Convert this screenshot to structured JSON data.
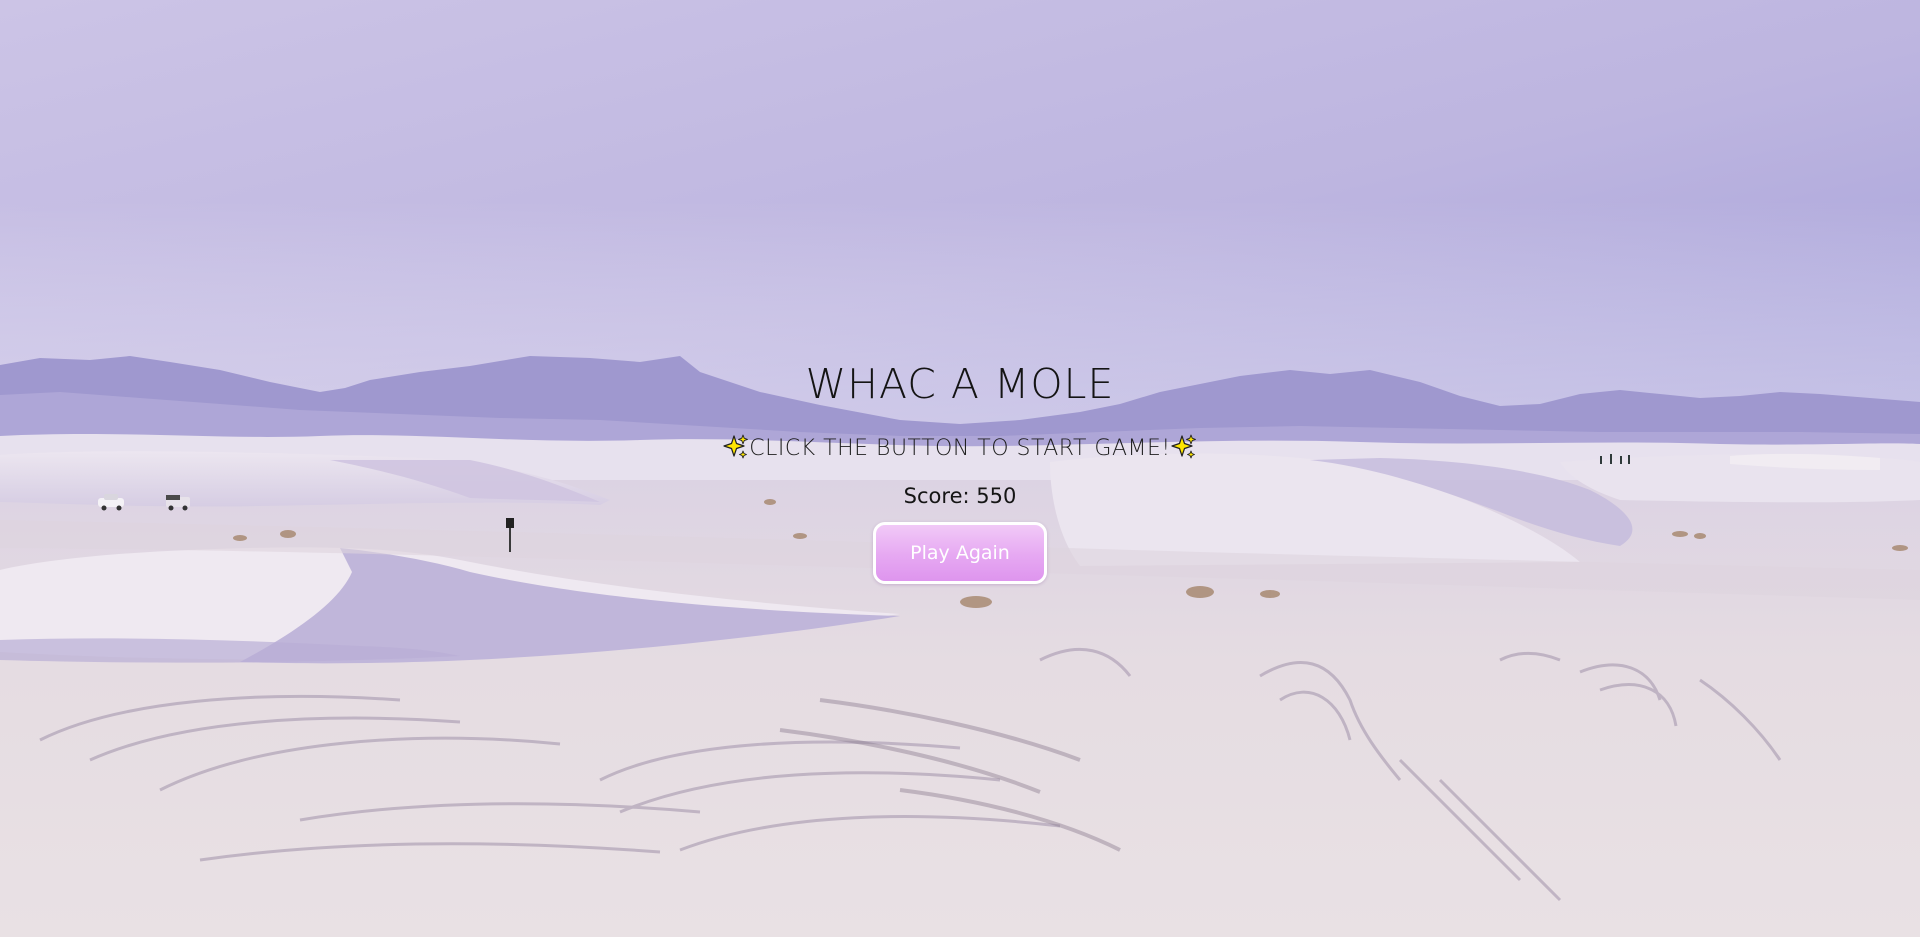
{
  "game": {
    "title": "WHAC A MOLE",
    "instruction": "CLICK THE BUTTON TO START GAME!",
    "score_label": "Score: 550",
    "play_button_label": "Play Again"
  },
  "icons": {
    "sparkle_left": "sparkles-icon",
    "sparkle_right": "sparkles-icon"
  },
  "colors": {
    "sky_top": "#a8a3dc",
    "sand": "#e6dde3",
    "button_gradient_top": "#f1c9f7",
    "button_gradient_bottom": "#de95ee",
    "button_border": "#ffffff",
    "sparkle": "#ffe600"
  }
}
